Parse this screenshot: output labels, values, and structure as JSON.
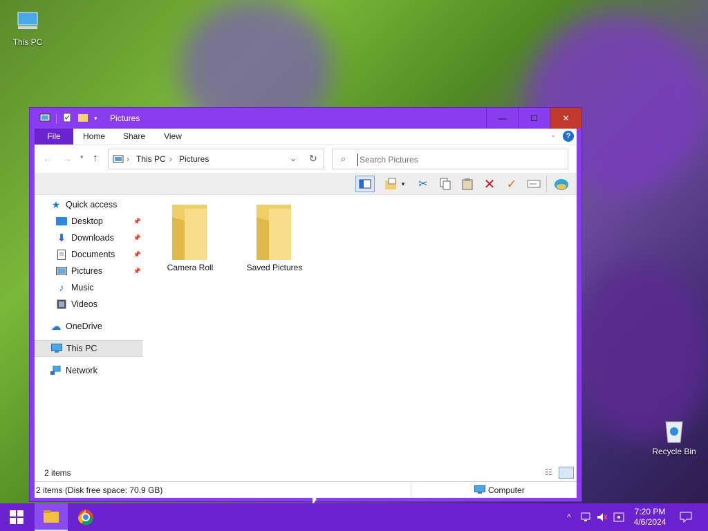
{
  "desktop": {
    "icons": [
      {
        "label": "This PC"
      },
      {
        "label": "Recycle Bin"
      }
    ]
  },
  "window": {
    "title": "Pictures",
    "controls": {
      "minimize": "—",
      "maximize": "☐",
      "close": "✕"
    }
  },
  "ribbon": {
    "tabs": [
      "File",
      "Home",
      "Share",
      "View"
    ],
    "help": "?"
  },
  "address": {
    "crumbs": [
      "This PC",
      "Pictures"
    ]
  },
  "search": {
    "placeholder": "Search Pictures"
  },
  "nav": {
    "quick_access": "Quick access",
    "items": [
      "Desktop",
      "Downloads",
      "Documents",
      "Pictures",
      "Music",
      "Videos"
    ],
    "onedrive": "OneDrive",
    "thispc": "This PC",
    "network": "Network"
  },
  "content": {
    "folders": [
      "Camera Roll",
      "Saved Pictures"
    ]
  },
  "status": {
    "items": "2 items",
    "disk": "2 items (Disk free space: 70.9 GB)",
    "location": "Computer"
  },
  "taskbar": {
    "time": "7:20 PM",
    "date": "4/6/2024"
  },
  "colors": {
    "accent": "#8a3cf0",
    "taskbar": "#6a22d0",
    "file_tab": "#6a22d0",
    "close": "#c0392b"
  }
}
